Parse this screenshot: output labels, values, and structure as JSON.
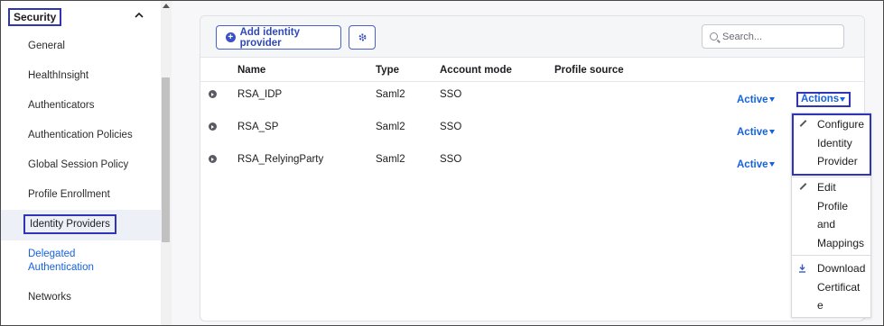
{
  "sidebar": {
    "section_title": "Security",
    "items": [
      {
        "label": "General"
      },
      {
        "label": "HealthInsight"
      },
      {
        "label": "Authenticators"
      },
      {
        "label": "Authentication Policies"
      },
      {
        "label": "Global Session Policy"
      },
      {
        "label": "Profile Enrollment"
      },
      {
        "label": "Identity Providers"
      },
      {
        "label": "Delegated Authentication"
      },
      {
        "label": "Networks"
      }
    ],
    "active_item": "Identity Providers"
  },
  "toolbar": {
    "add_label": "Add identity provider",
    "search_placeholder": "Search..."
  },
  "table": {
    "columns": [
      "Name",
      "Type",
      "Account mode",
      "Profile source"
    ],
    "rows": [
      {
        "name": "RSA_IDP",
        "type": "Saml2",
        "account_mode": "SSO",
        "profile_source": "",
        "status": "Active"
      },
      {
        "name": "RSA_SP",
        "type": "Saml2",
        "account_mode": "SSO",
        "profile_source": "",
        "status": "Active"
      },
      {
        "name": "RSA_RelyingParty",
        "type": "Saml2",
        "account_mode": "SSO",
        "profile_source": "",
        "status": "Active"
      }
    ]
  },
  "actions": {
    "label": "Actions",
    "menu": [
      {
        "icon": "pencil-icon",
        "lines": [
          "Configure",
          "Identity",
          "Provider"
        ]
      },
      {
        "icon": "pencil-icon",
        "lines": [
          "Edit",
          "Profile",
          "and",
          "Mappings"
        ]
      },
      {
        "icon": "download-icon",
        "lines": [
          "Download",
          "Certificat",
          "e"
        ]
      }
    ]
  },
  "colors": {
    "highlight_border": "#2f35b5",
    "link_blue": "#1662dd",
    "active_nav_bg": "#eef0f8"
  }
}
